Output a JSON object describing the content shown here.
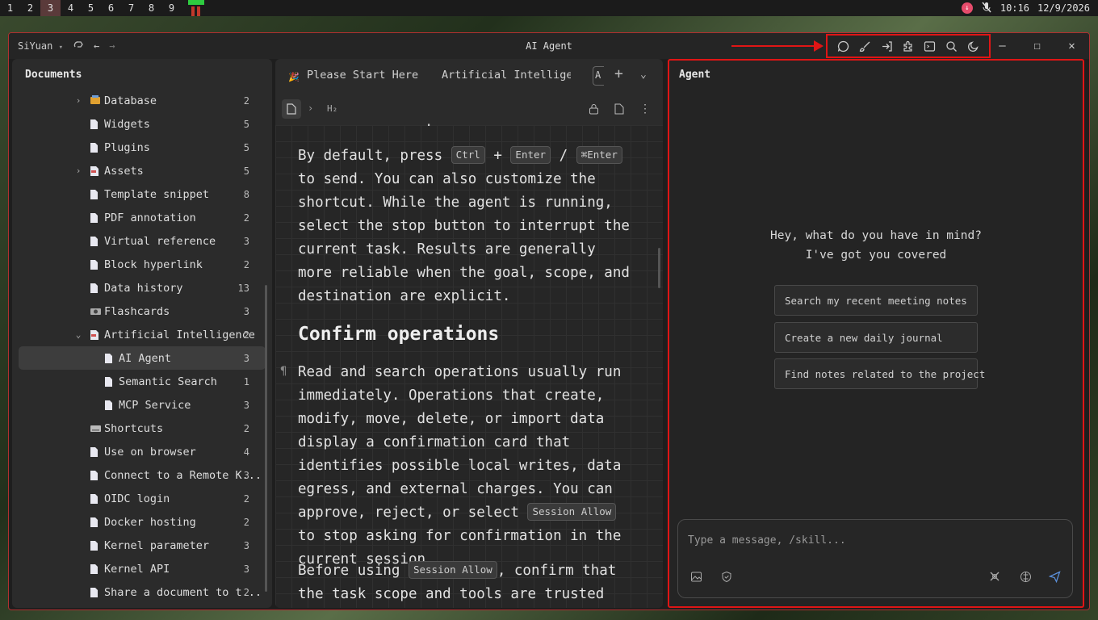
{
  "sysbar": {
    "workspaces": [
      "1",
      "2",
      "3",
      "4",
      "5",
      "6",
      "7",
      "8",
      "9"
    ],
    "active_workspace": "3",
    "time": "10:16",
    "date": "12/9/2026"
  },
  "window": {
    "app_name": "SiYuan",
    "title": "AI Agent",
    "toolbar_icons": [
      "chat-icon",
      "brush-icon",
      "sign-in-icon",
      "plugin-icon",
      "terminal-icon",
      "search-icon",
      "moon-icon"
    ]
  },
  "docs": {
    "title": "Documents",
    "items": [
      {
        "label": "Database",
        "count": "2"
      },
      {
        "label": "Widgets",
        "count": "5"
      },
      {
        "label": "Plugins",
        "count": "5"
      },
      {
        "label": "Assets",
        "count": "5"
      },
      {
        "label": "Template snippet",
        "count": "8"
      },
      {
        "label": "PDF annotation",
        "count": "2"
      },
      {
        "label": "Virtual reference",
        "count": "3"
      },
      {
        "label": "Block hyperlink",
        "count": "2"
      },
      {
        "label": "Data history",
        "count": "13"
      },
      {
        "label": "Flashcards",
        "count": "3"
      },
      {
        "label": "Artificial Intelligence",
        "count": "2"
      },
      {
        "label": "AI Agent",
        "count": "3"
      },
      {
        "label": "Semantic Search",
        "count": "1"
      },
      {
        "label": "MCP Service",
        "count": "3"
      },
      {
        "label": "Shortcuts",
        "count": "2"
      },
      {
        "label": "Use on browser",
        "count": "4"
      },
      {
        "label": "Connect to a Remote K...",
        "count": "3"
      },
      {
        "label": "OIDC login",
        "count": "2"
      },
      {
        "label": "Docker hosting",
        "count": "2"
      },
      {
        "label": "Kernel parameter",
        "count": "3"
      },
      {
        "label": "Kernel API",
        "count": "3"
      },
      {
        "label": "Share a document to t...",
        "count": "2"
      }
    ]
  },
  "editor": {
    "tabs": [
      "Please Start Here",
      "Artificial Intelligenc",
      "A"
    ],
    "crumb_heading": "H₂",
    "para1": {
      "t1": "By default, press",
      "k1": "Ctrl",
      "plus": "+",
      "k2": "Enter",
      "slash": "/",
      "k3": "⌘Enter",
      "t2": "to send. You can also customize the shortcut. While the agent is running, select the stop button to interrupt the current task. Results are generally more reliable when the goal, scope, and destination are explicit."
    },
    "heading": "Confirm operations",
    "para2": {
      "t1": "Read and search operations usually run immediately. Operations that create, modify, move, delete, or import data display a confirmation card that identifies possible local writes, data egress, and external charges. You can approve, reject, or select",
      "k1": "Session Allow",
      "t2": "to stop asking for confirmation in the current session."
    },
    "para3": {
      "t1": "Before using",
      "k1": "Session Allow",
      "t2": ", confirm that the task scope and tools are trusted because"
    }
  },
  "agent": {
    "title": "Agent",
    "greeting_line1": "Hey, what do you have in mind?",
    "greeting_line2": "I've got you covered",
    "suggestions": [
      "Search my recent meeting notes",
      "Create a new daily journal",
      "Find notes related to the project"
    ],
    "input_placeholder": "Type a message, /skill..."
  }
}
